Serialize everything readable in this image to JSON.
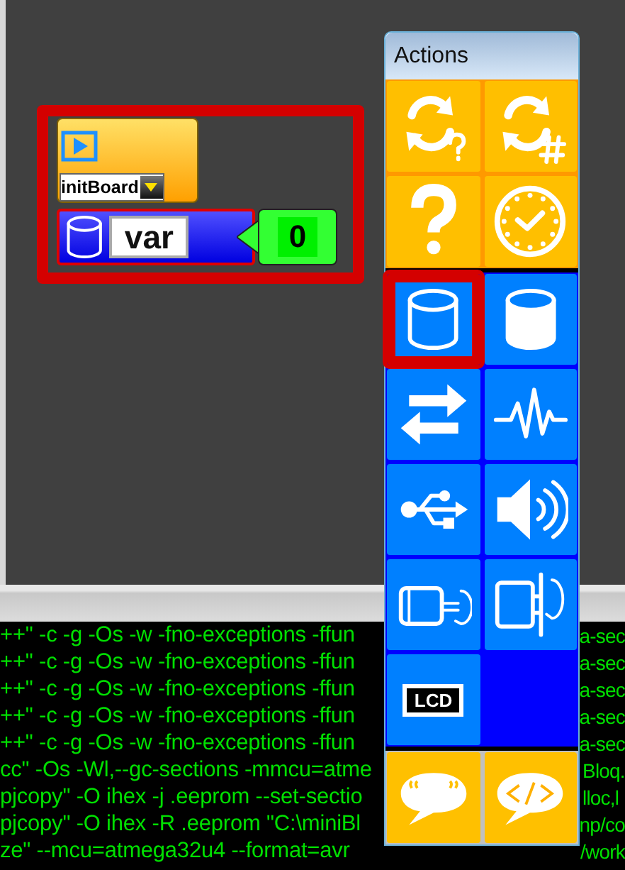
{
  "canvas": {
    "group": {
      "selected": true,
      "blocks": [
        {
          "kind": "init",
          "dropdown": "initBoard",
          "selected": false
        },
        {
          "kind": "variable",
          "value": "var",
          "selected": true
        },
        {
          "kind": "number",
          "value": "0",
          "selected": false
        }
      ]
    }
  },
  "palette": {
    "title": "Actions",
    "sections": [
      {
        "color": "#ff9900",
        "tiles": [
          {
            "kind": "loop-question",
            "color": "#ffbf00",
            "selected": false
          },
          {
            "kind": "loop-number",
            "color": "#ffbf00",
            "selected": false
          },
          {
            "kind": "question",
            "color": "#ffbf00",
            "selected": false
          },
          {
            "kind": "clock",
            "color": "#ffbf00",
            "selected": false
          }
        ]
      },
      {
        "color": "#0000ff",
        "tiles": [
          {
            "kind": "variable",
            "color": "#0080ff",
            "selected": true
          },
          {
            "kind": "variable-filled",
            "color": "#0080ff",
            "selected": false
          },
          {
            "kind": "arrows",
            "color": "#0080ff",
            "selected": false
          },
          {
            "kind": "wave",
            "color": "#0080ff",
            "selected": false
          },
          {
            "kind": "usb",
            "color": "#0080ff",
            "selected": false
          },
          {
            "kind": "speaker",
            "color": "#0080ff",
            "selected": false
          },
          {
            "kind": "motor",
            "color": "#0080ff",
            "selected": false
          },
          {
            "kind": "servo",
            "color": "#0080ff",
            "selected": false
          },
          {
            "kind": "lcd",
            "label": "LCD",
            "color": "#0080ff",
            "selected": false
          },
          {
            "kind": "empty",
            "color": "#0000ff",
            "selected": false
          }
        ]
      },
      {
        "color": "#c0c0c0",
        "tiles": [
          {
            "kind": "comment",
            "color": "#ffc000",
            "selected": false
          },
          {
            "kind": "code",
            "color": "#ffc000",
            "selected": false
          }
        ]
      }
    ]
  },
  "console": {
    "lines": [
      {
        "left": "++\" -c -g -Os -w -fno-exceptions -ffun",
        "right": "a-sec"
      },
      {
        "left": "++\" -c -g -Os -w -fno-exceptions -ffun",
        "right": "a-sec"
      },
      {
        "left": "++\" -c -g -Os -w -fno-exceptions -ffun",
        "right": "a-sec"
      },
      {
        "left": "++\" -c -g -Os -w -fno-exceptions -ffun",
        "right": "a-sec"
      },
      {
        "left": "++\" -c -g -Os -w -fno-exceptions -ffun",
        "right": "a-sec"
      },
      {
        "left": "cc\" -Os -Wl,--gc-sections -mmcu=atme",
        "right": "Bloq."
      },
      {
        "left": "pjcopy\" -O ihex -j .eeprom --set-sectio",
        "right": "lloc,l"
      },
      {
        "left": "pjcopy\" -O ihex -R .eeprom \"C:\\miniBl",
        "right": "np/co"
      },
      {
        "left": "ze\" --mcu=atmega32u4 --format=avr",
        "right": "/work"
      }
    ]
  }
}
